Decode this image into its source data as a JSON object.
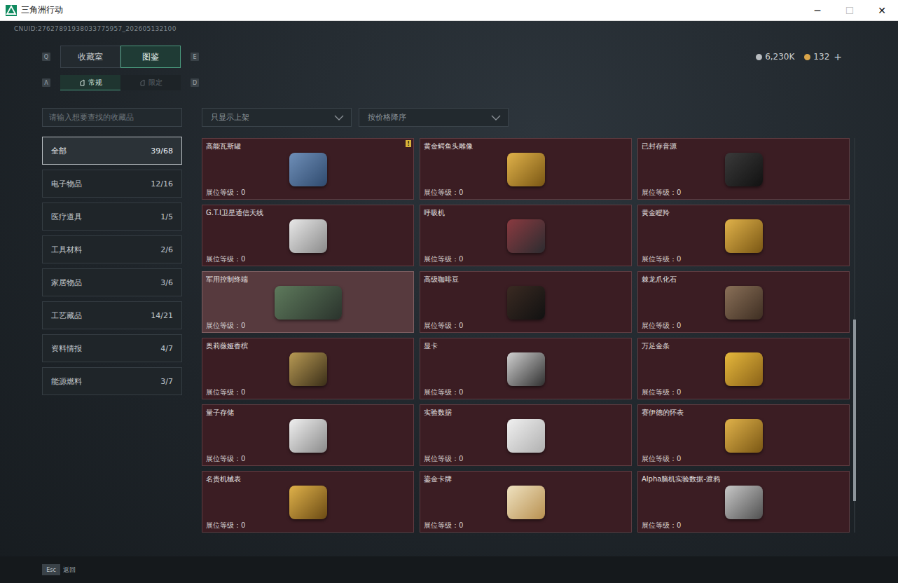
{
  "window": {
    "title": "三角洲行动",
    "controls": [
      "─",
      "☐",
      "✕"
    ]
  },
  "account_id": "CNUID:27627891938033775957_202605132100",
  "currency": [
    {
      "amount": "6,230K",
      "color": "#b8bcc0"
    },
    {
      "amount": "132",
      "color": "#d9a54a"
    }
  ],
  "add_button": "+",
  "tabs": {
    "prev_key": "Q",
    "next_key": "E",
    "items": [
      {
        "label": "收藏室",
        "selected": false
      },
      {
        "label": "图鉴",
        "selected": true
      }
    ]
  },
  "subtabs": {
    "prev_key": "A",
    "next_key": "D",
    "items": [
      {
        "label": "常规",
        "selected": true
      },
      {
        "label": "限定",
        "selected": false
      }
    ]
  },
  "search": {
    "placeholder": "请输入想要查找的收藏品"
  },
  "filters": [
    "只显示上架",
    "按价格降序"
  ],
  "categories": [
    {
      "label": "全部",
      "count": "39/68",
      "selected": true
    },
    {
      "label": "电子物品",
      "count": "12/16",
      "selected": false
    },
    {
      "label": "医疗道具",
      "count": "1/5",
      "selected": false
    },
    {
      "label": "工具材料",
      "count": "2/6",
      "selected": false
    },
    {
      "label": "家居物品",
      "count": "3/6",
      "selected": false
    },
    {
      "label": "工艺藏品",
      "count": "14/21",
      "selected": false
    },
    {
      "label": "资料情报",
      "count": "4/7",
      "selected": false
    },
    {
      "label": "能源燃料",
      "count": "3/7",
      "selected": false
    }
  ],
  "card_label": "展位等级：",
  "items": [
    {
      "name": "高能瓦斯罐",
      "level": "0",
      "selected": false,
      "badge": "!"
    },
    {
      "name": "黄金鳄鱼头雕像",
      "level": "0",
      "selected": false
    },
    {
      "name": "已封存音源",
      "level": "0",
      "selected": false
    },
    {
      "name": "G.T.I卫星通信天线",
      "level": "0",
      "selected": false
    },
    {
      "name": "呼吸机",
      "level": "0",
      "selected": false
    },
    {
      "name": "黄金瞪羚",
      "level": "0",
      "selected": false
    },
    {
      "name": "军用控制终端",
      "level": "0",
      "selected": true
    },
    {
      "name": "高级咖啡豆",
      "level": "0",
      "selected": false
    },
    {
      "name": "棘龙爪化石",
      "level": "0",
      "selected": false
    },
    {
      "name": "奥莉薇娅香槟",
      "level": "0",
      "selected": false
    },
    {
      "name": "显卡",
      "level": "0",
      "selected": false
    },
    {
      "name": "万足金条",
      "level": "0",
      "selected": false
    },
    {
      "name": "量子存储",
      "level": "0",
      "selected": false
    },
    {
      "name": "实验数据",
      "level": "0",
      "selected": false
    },
    {
      "name": "赛伊德的怀表",
      "level": "0",
      "selected": false
    },
    {
      "name": "名贵机械表",
      "level": "0",
      "selected": false
    },
    {
      "name": "鎏金卡牌",
      "level": "0",
      "selected": false
    },
    {
      "name": "Alpha脑机实验数据-渡鸦",
      "level": "0",
      "selected": false
    }
  ],
  "scrollbar": {
    "offset": 0.46,
    "size": 0.46
  },
  "footer": {
    "key": "Esc",
    "label": "返回"
  }
}
